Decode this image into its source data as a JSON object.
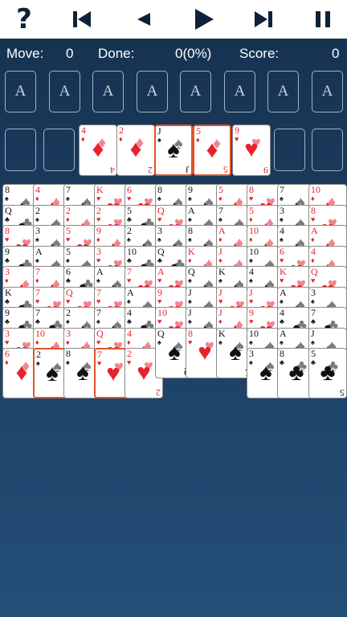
{
  "toolbar": {
    "help_glyph": "?",
    "buttons": [
      "help-icon",
      "skip-to-start-icon",
      "step-back-icon",
      "play-icon",
      "skip-to-end-icon",
      "pause-icon"
    ]
  },
  "status": {
    "move_label": "Move:",
    "move_value": "0",
    "done_label": "Done:",
    "done_value": "0(0%)",
    "score_label": "Score:",
    "score_value": "0"
  },
  "foundations": [
    "A",
    "A",
    "A",
    "A",
    "A",
    "A",
    "A",
    "A"
  ],
  "freecells": [
    {
      "card": null
    },
    {
      "card": null
    },
    {
      "card": {
        "rank": "4",
        "suit": "diamond"
      }
    },
    {
      "card": {
        "rank": "2",
        "suit": "diamond"
      }
    },
    {
      "card": {
        "rank": "J",
        "suit": "spade",
        "selected": true
      }
    },
    {
      "card": {
        "rank": "5",
        "suit": "diamond",
        "selected": true
      }
    },
    {
      "card": {
        "rank": "9",
        "suit": "heart"
      }
    },
    {
      "card": null
    },
    {
      "card": null
    }
  ],
  "tableau": [
    {
      "cards": [
        [
          "8",
          "spade"
        ],
        [
          "Q",
          "club"
        ],
        [
          "8",
          "heart"
        ],
        [
          "9",
          "club"
        ],
        [
          "3",
          "diamond"
        ],
        [
          "K",
          "club"
        ],
        [
          "9",
          "club"
        ],
        [
          "3",
          "heart"
        ],
        [
          "6",
          "diamond"
        ]
      ]
    },
    {
      "cards": [
        [
          "4",
          "diamond"
        ],
        [
          "2",
          "spade"
        ],
        [
          "3",
          "spade"
        ],
        [
          "A",
          "spade"
        ],
        [
          "7",
          "diamond"
        ],
        [
          "7",
          "heart"
        ],
        [
          "7",
          "club"
        ],
        [
          "10",
          "diamond"
        ],
        [
          "2",
          "spade",
          "sel"
        ]
      ]
    },
    {
      "cards": [
        [
          "7",
          "spade"
        ],
        [
          "2",
          "diamond"
        ],
        [
          "5",
          "heart"
        ],
        [
          "5",
          "spade"
        ],
        [
          "6",
          "club"
        ],
        [
          "Q",
          "heart"
        ],
        [
          "2",
          "spade"
        ],
        [
          "3",
          "diamond"
        ],
        [
          "8",
          "spade"
        ]
      ]
    },
    {
      "cards": [
        [
          "K",
          "heart"
        ],
        [
          "2",
          "heart"
        ],
        [
          "9",
          "diamond"
        ],
        [
          "3",
          "heart"
        ],
        [
          "A",
          "spade"
        ],
        [
          "7",
          "heart"
        ],
        [
          "7",
          "spade"
        ],
        [
          "Q",
          "heart"
        ],
        [
          "7",
          "heart",
          "sel"
        ]
      ]
    },
    {
      "cards": [
        [
          "6",
          "heart"
        ],
        [
          "5",
          "club"
        ],
        [
          "2",
          "spade"
        ],
        [
          "10",
          "club"
        ],
        [
          "7",
          "heart"
        ],
        [
          "A",
          "spade"
        ],
        [
          "4",
          "club"
        ],
        [
          "4",
          "diamond"
        ],
        [
          "2",
          "heart"
        ]
      ]
    },
    {
      "cards": [
        [
          "8",
          "spade"
        ],
        [
          "Q",
          "heart"
        ],
        [
          "3",
          "spade"
        ],
        [
          "Q",
          "club"
        ],
        [
          "A",
          "heart"
        ],
        [
          "9",
          "heart"
        ],
        [
          "10",
          "heart"
        ],
        [
          "Q",
          "spade"
        ]
      ]
    },
    {
      "cards": [
        [
          "9",
          "spade"
        ],
        [
          "A",
          "spade"
        ],
        [
          "8",
          "spade"
        ],
        [
          "K",
          "diamond"
        ],
        [
          "Q",
          "spade"
        ],
        [
          "J",
          "spade"
        ],
        [
          "J",
          "spade"
        ],
        [
          "8",
          "heart"
        ]
      ]
    },
    {
      "cards": [
        [
          "5",
          "diamond"
        ],
        [
          "7",
          "spade"
        ],
        [
          "A",
          "diamond"
        ],
        [
          "J",
          "diamond"
        ],
        [
          "K",
          "spade"
        ],
        [
          "J",
          "heart"
        ],
        [
          "J",
          "diamond"
        ],
        [
          "K",
          "spade"
        ]
      ]
    },
    {
      "cards": [
        [
          "8",
          "heart"
        ],
        [
          "5",
          "diamond"
        ],
        [
          "10",
          "diamond"
        ],
        [
          "10",
          "spade"
        ],
        [
          "4",
          "spade"
        ],
        [
          "J",
          "heart"
        ],
        [
          "9",
          "heart"
        ],
        [
          "10",
          "spade"
        ],
        [
          "3",
          "spade"
        ]
      ]
    },
    {
      "cards": [
        [
          "7",
          "spade"
        ],
        [
          "3",
          "spade"
        ],
        [
          "4",
          "spade"
        ],
        [
          "6",
          "heart"
        ],
        [
          "K",
          "heart"
        ],
        [
          "A",
          "spade"
        ],
        [
          "4",
          "club"
        ],
        [
          "A",
          "spade"
        ],
        [
          "8",
          "club"
        ]
      ]
    },
    {
      "cards": [
        [
          "10",
          "diamond"
        ],
        [
          "8",
          "heart"
        ],
        [
          "A",
          "diamond"
        ],
        [
          "4",
          "diamond"
        ],
        [
          "Q",
          "heart"
        ],
        [
          "3",
          "spade"
        ],
        [
          "7",
          "club"
        ],
        [
          "J",
          "spade"
        ],
        [
          "5",
          "club"
        ]
      ]
    }
  ]
}
